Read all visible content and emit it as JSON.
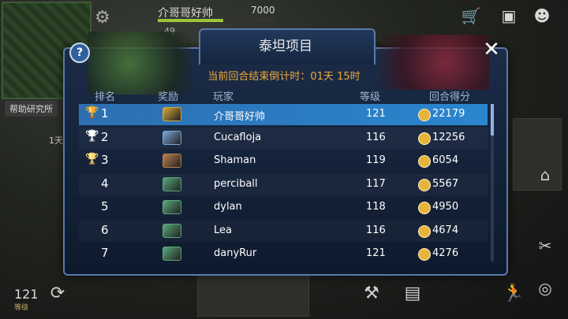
{
  "hud": {
    "player_name": "介哥哥好帅",
    "top_score": "7000",
    "small_level": "49",
    "xp_fraction": 0.55,
    "help_research_label": "帮助研究所",
    "side_time": "1天",
    "bottom_level_num": "121",
    "bottom_level_label": "等级"
  },
  "panel": {
    "title": "泰坦项目",
    "countdown": "当前回合结束倒计时：01天 15时",
    "headers": {
      "rank": "排名",
      "reward": "奖励",
      "player": "玩家",
      "level": "等级",
      "score": "回合得分"
    },
    "rows": [
      {
        "rank": "1",
        "player": "介哥哥好帅",
        "level": "121",
        "score": "22179",
        "trophy": "gold",
        "reward_color": "#d7a73c"
      },
      {
        "rank": "2",
        "player": "Cucafloja",
        "level": "116",
        "score": "12256",
        "trophy": "silver",
        "reward_color": "#7aa6d6"
      },
      {
        "rank": "3",
        "player": "Shaman",
        "level": "119",
        "score": "6054",
        "trophy": "bronze",
        "reward_color": "#b9804f"
      },
      {
        "rank": "4",
        "player": "perciball",
        "level": "117",
        "score": "5567",
        "trophy": "",
        "reward_color": "#5aa87a"
      },
      {
        "rank": "5",
        "player": "dylan",
        "level": "118",
        "score": "4950",
        "trophy": "",
        "reward_color": "#5aa87a"
      },
      {
        "rank": "6",
        "player": "Lea",
        "level": "116",
        "score": "4674",
        "trophy": "",
        "reward_color": "#5aa87a"
      },
      {
        "rank": "7",
        "player": "danyRur",
        "level": "121",
        "score": "4276",
        "trophy": "",
        "reward_color": "#5aa87a"
      }
    ]
  },
  "colors": {
    "accent_select": "#2d6fb1",
    "countdown": "#f2a93b",
    "gold": "#e8b83a",
    "silver": "#c9ced6",
    "bronze": "#c08446"
  }
}
